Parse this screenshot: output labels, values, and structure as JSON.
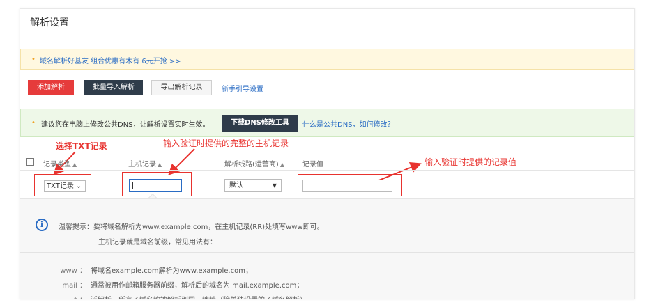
{
  "page": {
    "title": "解析设置"
  },
  "promo": {
    "dot": "•",
    "text": "域名解析好基友 组合优惠有木有 6元开抢 >>"
  },
  "toolbar": {
    "add_label": "添加解析",
    "batch_label": "批量导入解析",
    "export_label": "导出解析记录",
    "guide_label": "新手引导设置"
  },
  "dns_notice": {
    "dot": "•",
    "text": "建议您在电脑上修改公共DNS，让解析设置实时生效。",
    "download_label": "下载DNS修改工具",
    "link_label": "什么是公共DNS，如何修改？"
  },
  "annotations": {
    "select_txt": "选择TXT记录",
    "host_hint": "输入验证时提供的完整的主机记录",
    "value_hint": "输入验证时提供的记录值",
    "color": "#e8332f"
  },
  "table": {
    "headers": {
      "type": "记录类型",
      "host": "主机记录",
      "line": "解析线路(运营商)",
      "value": "记录值"
    },
    "sort_icon": "▲",
    "row": {
      "type_value": "TXT记录",
      "type_caret": "⌄",
      "line_value": "默认",
      "line_caret": "▼",
      "host_value": "",
      "record_value": ""
    }
  },
  "tips": {
    "icon": "i",
    "line1": "温馨提示：要将域名解析为www.example.com，在主机记录(RR)处填写www即可。",
    "line2": "主机记录就是域名前缀，常见用法有：",
    "examples": [
      {
        "key": "www ：",
        "value": "将域名example.com解析为www.example.com；"
      },
      {
        "key": "mail ：",
        "value": "通常被用作邮箱服务器前缀，解析后的域名为 mail.example.com；"
      },
      {
        "key": "* ：",
        "value": "泛解析，所有子域名均被解析到同一地址（除单独设置的子域名解析）。"
      }
    ]
  },
  "colors": {
    "accent_blue": "#2a6cc4",
    "add_red": "#e63b3b",
    "dark_button": "#2f3c4a",
    "promo_bg": "#fff8e0",
    "dns_bg": "#eef8e8"
  }
}
